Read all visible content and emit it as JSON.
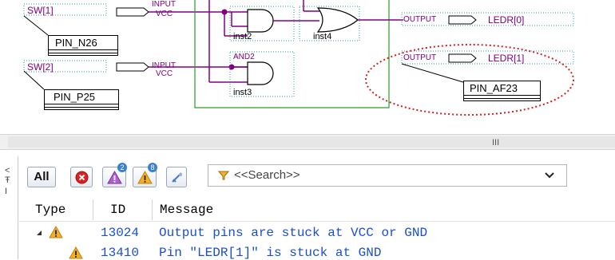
{
  "schematic": {
    "inputs": [
      {
        "name": "SW[1]",
        "type_label": "INPUT",
        "vcc_label": "VCC",
        "pin": "PIN_N26"
      },
      {
        "name": "SW[2]",
        "type_label": "INPUT",
        "vcc_label": "VCC",
        "pin": "PIN_P25"
      }
    ],
    "gates": [
      {
        "instance": "inst2",
        "title": ""
      },
      {
        "instance": "inst3",
        "title": "AND2"
      },
      {
        "instance": "inst4",
        "title": ""
      }
    ],
    "outputs": [
      {
        "name": "LEDR[0]",
        "type_label": "OUTPUT",
        "pin": ""
      },
      {
        "name": "LEDR[1]",
        "type_label": "OUTPUT",
        "pin": "PIN_AF23"
      }
    ],
    "highlight_color": "#d42020",
    "wire_color": "#800080",
    "group_color": "#2a9a2a",
    "dotted_color": "#20a0a0"
  },
  "scrollbar": {
    "grip": "III"
  },
  "left_strip": {
    "chars": [
      "<",
      "Ŧ",
      "I"
    ]
  },
  "messages": {
    "filters": {
      "all_label": "All",
      "error_icon": "error-icon",
      "critical_warning_icon": "critical-warning-icon",
      "critical_warning_count": "2",
      "warning_icon": "warning-icon",
      "warning_count": "8",
      "suppress_icon": "suppress-icon"
    },
    "search": {
      "placeholder": "<<Search>>"
    },
    "columns": [
      "Type",
      "ID",
      "Message"
    ],
    "rows": [
      {
        "type_icon": "warning-icon",
        "id": "13024",
        "message": "Output pins are stuck at VCC or GND"
      },
      {
        "type_icon": "warning-icon",
        "id": "13410",
        "message": "Pin \"LEDR[1]\" is stuck at GND"
      }
    ]
  }
}
